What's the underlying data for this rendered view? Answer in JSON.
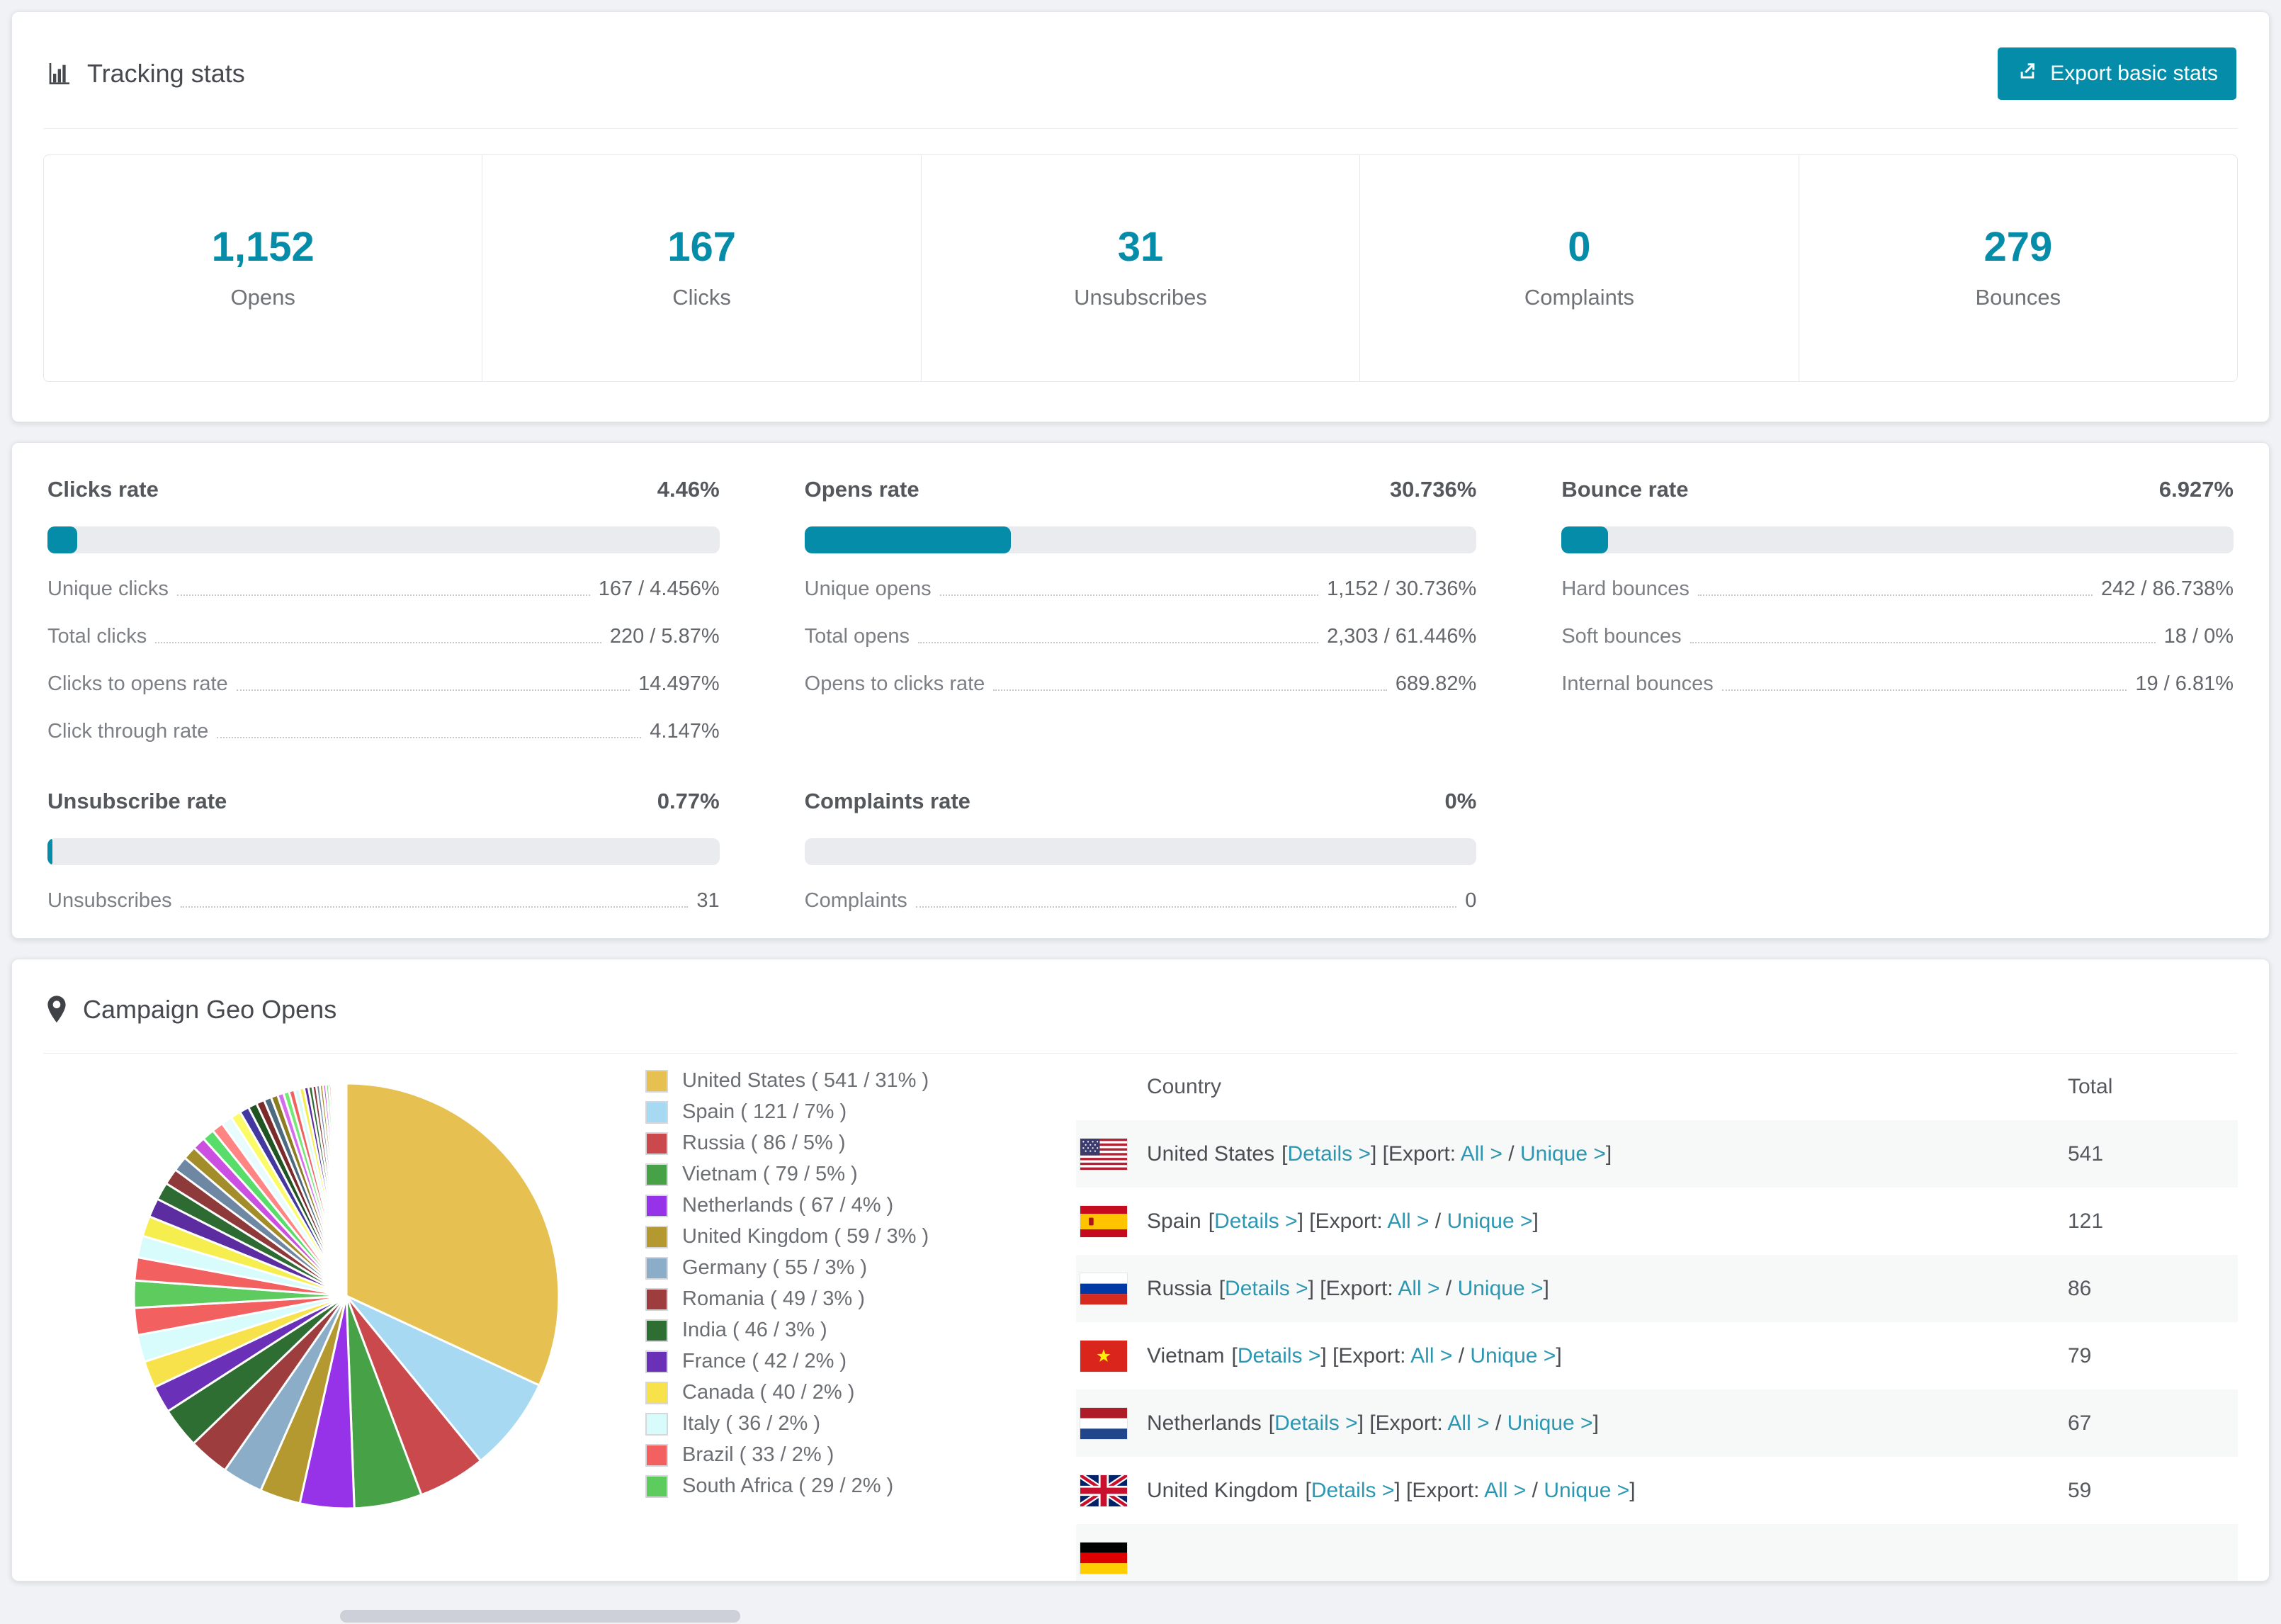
{
  "accent_color": "#058ca8",
  "link_color": "#2d97b2",
  "icons": {
    "title_icon": "bar-chart-icon",
    "export_icon": "export-icon",
    "geo_icon": "map-pin-icon"
  },
  "tracking": {
    "title": "Tracking stats",
    "export_button": "Export basic stats",
    "stats": [
      {
        "value": "1,152",
        "label": "Opens"
      },
      {
        "value": "167",
        "label": "Clicks"
      },
      {
        "value": "31",
        "label": "Unsubscribes"
      },
      {
        "value": "0",
        "label": "Complaints"
      },
      {
        "value": "279",
        "label": "Bounces"
      }
    ]
  },
  "rates": [
    {
      "title": "Clicks rate",
      "value": "4.46%",
      "percent": 4.46,
      "rows": [
        [
          "Unique clicks",
          "167 / 4.456%"
        ],
        [
          "Total clicks",
          "220 / 5.87%"
        ],
        [
          "Clicks to opens rate",
          "14.497%"
        ],
        [
          "Click through rate",
          "4.147%"
        ]
      ]
    },
    {
      "title": "Opens rate",
      "value": "30.736%",
      "percent": 30.736,
      "rows": [
        [
          "Unique opens",
          "1,152 / 30.736%"
        ],
        [
          "Total opens",
          "2,303 / 61.446%"
        ],
        [
          "Opens to clicks rate",
          "689.82%"
        ]
      ]
    },
    {
      "title": "Bounce rate",
      "value": "6.927%",
      "percent": 6.927,
      "rows": [
        [
          "Hard bounces",
          "242 / 86.738%"
        ],
        [
          "Soft bounces",
          "18 / 0%"
        ],
        [
          "Internal bounces",
          "19 / 6.81%"
        ]
      ]
    },
    {
      "title": "Unsubscribe rate",
      "value": "0.77%",
      "percent": 0.77,
      "rows": [
        [
          "Unsubscribes",
          "31"
        ]
      ]
    },
    {
      "title": "Complaints rate",
      "value": "0%",
      "percent": 0,
      "rows": [
        [
          "Complaints",
          "0"
        ]
      ]
    }
  ],
  "geo": {
    "title": "Campaign Geo Opens",
    "table": {
      "country_header": "Country",
      "total_header": "Total",
      "bracket_open": "[",
      "bracket_close": "]",
      "details_label": "Details >",
      "export_prefix": "[Export: ",
      "all_label": "All >",
      "slash": " / ",
      "unique_label": "Unique >",
      "rows": [
        {
          "country": "United States",
          "flag": "us",
          "total": "541"
        },
        {
          "country": "Spain",
          "flag": "es",
          "total": "121"
        },
        {
          "country": "Russia",
          "flag": "ru",
          "total": "86"
        },
        {
          "country": "Vietnam",
          "flag": "vn",
          "total": "79"
        },
        {
          "country": "Netherlands",
          "flag": "nl",
          "total": "67"
        },
        {
          "country": "United Kingdom",
          "flag": "gb",
          "total": "59"
        },
        {
          "country": "",
          "flag": "de",
          "total": ""
        }
      ]
    }
  },
  "chart_data": {
    "type": "pie",
    "title": "Campaign Geo Opens",
    "legend_position": "right",
    "slices": [
      {
        "label": "United States",
        "opens": 541,
        "percent": 31,
        "color": "#e6c151"
      },
      {
        "label": "Spain",
        "opens": 121,
        "percent": 7,
        "color": "#a8d9f2"
      },
      {
        "label": "Russia",
        "opens": 86,
        "percent": 5,
        "color": "#c9494d"
      },
      {
        "label": "Vietnam",
        "opens": 79,
        "percent": 5,
        "color": "#47a247"
      },
      {
        "label": "Netherlands",
        "opens": 67,
        "percent": 4,
        "color": "#9632e8"
      },
      {
        "label": "United Kingdom",
        "opens": 59,
        "percent": 3,
        "color": "#b3992f"
      },
      {
        "label": "Germany",
        "opens": 55,
        "percent": 3,
        "color": "#8badc7"
      },
      {
        "label": "Romania",
        "opens": 49,
        "percent": 3,
        "color": "#9d3d3d"
      },
      {
        "label": "India",
        "opens": 46,
        "percent": 3,
        "color": "#2f6e33"
      },
      {
        "label": "France",
        "opens": 42,
        "percent": 2,
        "color": "#6a30b8"
      },
      {
        "label": "Canada",
        "opens": 40,
        "percent": 2,
        "color": "#f8e24b"
      },
      {
        "label": "Italy",
        "opens": 36,
        "percent": 2,
        "color": "#d8fbfb"
      },
      {
        "label": "Brazil",
        "opens": 33,
        "percent": 2,
        "color": "#f26060"
      },
      {
        "label": "South Africa",
        "opens": 29,
        "percent": 2,
        "color": "#5ecb5e"
      }
    ],
    "other_slices": {
      "values": [
        1.7,
        1.6,
        1.5,
        1.4,
        1.3,
        1.2,
        1.1,
        1.0,
        0.95,
        0.9,
        0.85,
        0.8,
        0.75,
        0.7,
        0.65,
        0.6,
        0.55,
        0.5,
        0.45,
        0.42,
        0.4,
        0.38,
        0.35,
        0.32,
        0.3,
        0.28,
        0.26,
        0.24,
        0.22,
        0.2,
        0.18,
        0.16,
        0.14,
        0.13,
        0.12,
        0.11,
        0.1,
        0.09,
        0.08,
        0.07,
        0.06,
        0.05
      ],
      "colors": [
        "#f26060",
        "#d8fbfb",
        "#f6ee4e",
        "#5b2da0",
        "#2e6b33",
        "#8f3a3a",
        "#6e87a3",
        "#a38c2a",
        "#cb4fe0",
        "#58dd6a",
        "#ff8585",
        "#e8fbff",
        "#fbfb67",
        "#4338a0",
        "#205423",
        "#7c2b2b",
        "#4d6a80",
        "#8c7d22",
        "#d76cf0",
        "#74e874"
      ]
    }
  }
}
